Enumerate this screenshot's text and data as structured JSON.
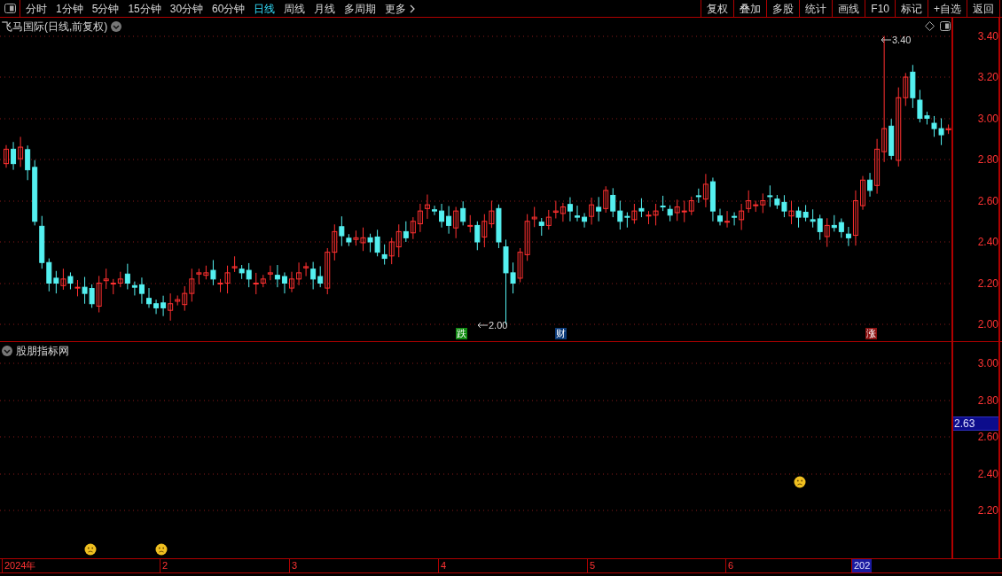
{
  "toolbar": {
    "periods": [
      {
        "label": "分时",
        "selected": false
      },
      {
        "label": "1分钟",
        "selected": false
      },
      {
        "label": "5分钟",
        "selected": false
      },
      {
        "label": "15分钟",
        "selected": false
      },
      {
        "label": "30分钟",
        "selected": false
      },
      {
        "label": "60分钟",
        "selected": false
      },
      {
        "label": "日线",
        "selected": true
      },
      {
        "label": "周线",
        "selected": false
      },
      {
        "label": "月线",
        "selected": false
      },
      {
        "label": "多周期",
        "selected": false
      },
      {
        "label": "更多",
        "selected": false
      }
    ],
    "actions": [
      "复权",
      "叠加",
      "多股",
      "统计",
      "画线",
      "F10",
      "标记",
      "+自选",
      "返回"
    ]
  },
  "main_chart": {
    "title": "飞马国际(日线,前复权)",
    "y_ticks": [
      "3.40",
      "3.20",
      "3.00",
      "2.80",
      "2.60",
      "2.40",
      "2.20",
      "2.00"
    ],
    "annotations": [
      {
        "text": "3.40"
      },
      {
        "text": "2.00"
      }
    ],
    "event_markers": [
      {
        "label": "跌",
        "color": "#108a10"
      },
      {
        "label": "财",
        "color": "#0b3a78"
      },
      {
        "label": "涨",
        "color": "#8a1010"
      }
    ]
  },
  "indicator_panel": {
    "title": "股朋指标网",
    "y_ticks": [
      "3.00",
      "2.80",
      "2.60",
      "2.40",
      "2.20"
    ],
    "current_value": "2.63"
  },
  "date_axis": [
    {
      "label": "2024年",
      "highlighted": false
    },
    {
      "label": "2",
      "highlighted": false
    },
    {
      "label": "3",
      "highlighted": false
    },
    {
      "label": "4",
      "highlighted": false
    },
    {
      "label": "5",
      "highlighted": false
    },
    {
      "label": "6",
      "highlighted": false
    },
    {
      "label": "202",
      "highlighted": true
    }
  ]
}
